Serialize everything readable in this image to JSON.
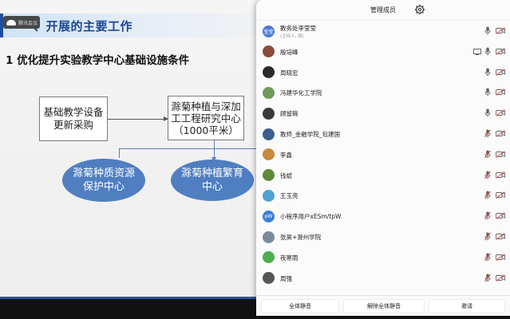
{
  "slide": {
    "meeting_chip": "腾讯会议",
    "title": "、开展的主要工作",
    "subtitle": "1  优化提升实验教学中心基础设施条件",
    "box1": [
      "基础教学设备",
      "更新采购"
    ],
    "box2": [
      "滁菊种植与深加",
      "工工程研究中心",
      "（1000平米）"
    ],
    "node1": [
      "滁菊种质资源",
      "保护中心"
    ],
    "node2": [
      "滁菊种植繁育",
      "中心"
    ]
  },
  "panel": {
    "title": "管理成员",
    "settings_icon": "gear-icon",
    "members": [
      {
        "name": "教务处李莹莹",
        "sub": "(主持人, 我)",
        "avatar": "莹莹",
        "avatar_color": "#4a7bd4",
        "mic": "on",
        "cam": "off",
        "screen": false
      },
      {
        "name": "殷培峰",
        "sub": "",
        "avatar": "",
        "avatar_color": "#8c4b3c",
        "mic": "on",
        "cam": "off",
        "screen": true
      },
      {
        "name": "周晓宏",
        "sub": "",
        "avatar": "",
        "avatar_color": "#2b2b2b",
        "mic": "on",
        "cam": "off",
        "screen": false
      },
      {
        "name": "冯建华化工学院",
        "sub": "",
        "avatar": "",
        "avatar_color": "#6e9a5a",
        "mic": "on",
        "cam": "off",
        "screen": false
      },
      {
        "name": "顾留碗",
        "sub": "",
        "avatar": "",
        "avatar_color": "#3a3a3a",
        "mic": "on",
        "cam": "off",
        "screen": false
      },
      {
        "name": "教师_金融学院_包建国",
        "sub": "",
        "avatar": "",
        "avatar_color": "#3a5f8c",
        "mic": "off",
        "cam": "off",
        "screen": false
      },
      {
        "name": "李鑫",
        "sub": "",
        "avatar": "",
        "avatar_color": "#c88a3a",
        "mic": "off",
        "cam": "off",
        "screen": false
      },
      {
        "name": "钱斌",
        "sub": "",
        "avatar": "",
        "avatar_color": "#5d8a3a",
        "mic": "off",
        "cam": "off",
        "screen": false
      },
      {
        "name": "王玉亮",
        "sub": "",
        "avatar": "",
        "avatar_color": "#4fa3d1",
        "mic": "off",
        "cam": "off",
        "screen": false
      },
      {
        "name": "小程序用户xESm/tpW",
        "sub": "",
        "avatar": "pW",
        "avatar_color": "#3a7fd6",
        "mic": "off",
        "cam": "off",
        "screen": false
      },
      {
        "name": "张昊+滁州学院",
        "sub": "",
        "avatar": "",
        "avatar_color": "#7a8a9a",
        "mic": "off",
        "cam": "off",
        "screen": false
      },
      {
        "name": "夜寒雨",
        "sub": "",
        "avatar": "",
        "avatar_color": "#4caf50",
        "mic": "off",
        "cam": "off",
        "screen": false
      },
      {
        "name": "周强",
        "sub": "",
        "avatar": "",
        "avatar_color": "#555555",
        "mic": "off",
        "cam": "off",
        "screen": false
      }
    ]
  },
  "footer": {
    "mute_all": "全体静音",
    "unmute_all": "解除全体静音",
    "invite": "邀请"
  }
}
